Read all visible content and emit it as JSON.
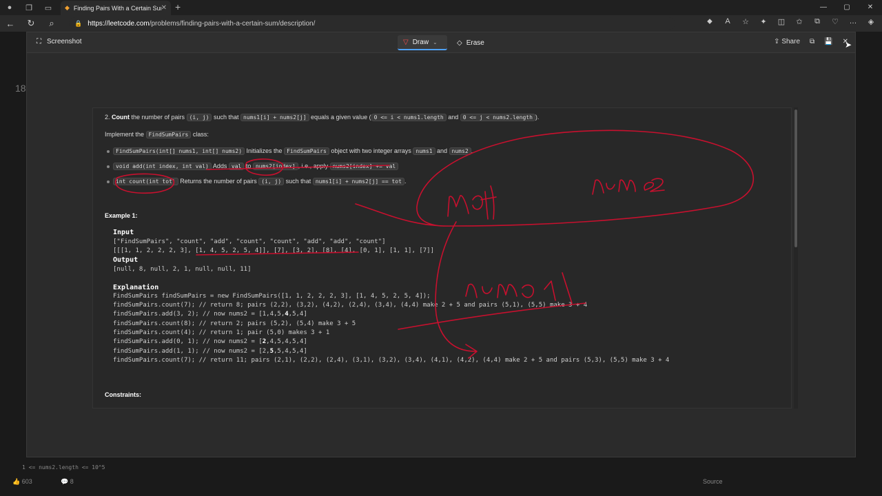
{
  "browser": {
    "tab_title": "Finding Pairs With a Certain Sum",
    "url_host": "https://leetcode.com",
    "url_path": "/problems/finding-pairs-with-a-certain-sum/description/"
  },
  "overlay": {
    "title": "Screenshot",
    "draw_label": "Draw",
    "erase_label": "Erase",
    "share_label": "Share"
  },
  "content": {
    "line2_pre": "2. ",
    "line2_count": "Count",
    "line2_a": " the number of pairs ",
    "line2_code1": "(i, j)",
    "line2_b": " such that ",
    "line2_code2": "nums1[i] + nums2[j]",
    "line2_c": " equals a given value (",
    "line2_code3": "0 <= i < nums1.length",
    "line2_d": " and ",
    "line2_code4": "0 <= j < nums2.length",
    "line2_e": ").",
    "impl_a": "Implement the ",
    "impl_code": "FindSumPairs",
    "impl_b": " class:",
    "b1_code1": "FindSumPairs(int[] nums1, int[] nums2)",
    "b1_a": " Initializes the ",
    "b1_code2": "FindSumPairs",
    "b1_b": " object with two integer arrays ",
    "b1_code3": "nums1",
    "b1_c": " and ",
    "b1_code4": "nums2",
    "b1_d": ".",
    "b2_code1": "void add(int index, int val)",
    "b2_a": " Adds ",
    "b2_code2": "val",
    "b2_b": " to ",
    "b2_code3": "nums2[index]",
    "b2_c": ", i.e., apply ",
    "b2_code4": "nums2[index] += val",
    "b3_code1": "int count(int tot)",
    "b3_a": " Returns the number of pairs ",
    "b3_code2": "(i, j)",
    "b3_b": " such that ",
    "b3_code3": "nums1[i] + nums2[j] == tot",
    "b3_c": ".",
    "example_title": "Example 1:",
    "input_label": "Input",
    "input_line1": "[\"FindSumPairs\", \"count\", \"add\", \"count\", \"count\", \"add\", \"add\", \"count\"]",
    "input_line2": "[[[1, 1, 2, 2, 2, 3], [1, 4, 5, 2, 5, 4]], [7], [3, 2], [8], [4], [0, 1], [1, 1], [7]]",
    "output_label": "Output",
    "output_line": "[null, 8, null, 2, 1, null, null, 11]",
    "explanation_label": "Explanation",
    "exp": [
      "FindSumPairs findSumPairs = new FindSumPairs([1, 1, 2, 2, 2, 3], [1, 4, 5, 2, 5, 4]);",
      "findSumPairs.count(7);  // return 8; pairs (2,2), (3,2), (4,2), (2,4), (3,4), (4,4) make 2 + 5 and pairs (5,1), (5,5) make 3 + 4",
      "findSumPairs.add(3, 2); // now nums2 = [1,4,5,",
      "findSumPairs.count(8);  // return 2; pairs (5,2), (5,4) make 3 + 5",
      "findSumPairs.count(4);  // return 1; pair (5,0) makes 3 + 1",
      "findSumPairs.add(0, 1); // now nums2 = [",
      "findSumPairs.add(1, 1); // now nums2 = [2,",
      "findSumPairs.count(7);  // return 11; pairs (2,1), (2,2), (2,4), (3,1), (3,2), (3,4), (4,1), (4,2), (4,4) make 2 + 5 and pairs (5,3), (5,5) make 3 + 4"
    ],
    "exp3_bold": "4",
    "exp3_tail": ",5,4]",
    "exp6_bold": "2",
    "exp6_tail": ",4,5,4,5,4]",
    "exp7_bold": "5",
    "exp7_tail": ",5,4,5,4]",
    "constraints_title": "Constraints:"
  },
  "annotations": {
    "ink_color": "#c8102e",
    "word_a": "nums1",
    "word_b": "nums 2",
    "word_c": "num1"
  },
  "background": {
    "likes": "603",
    "comments": "8",
    "footer_code": "1 <= nums2.length <= 10^5",
    "source_label": "Source",
    "problem_number": "18"
  }
}
